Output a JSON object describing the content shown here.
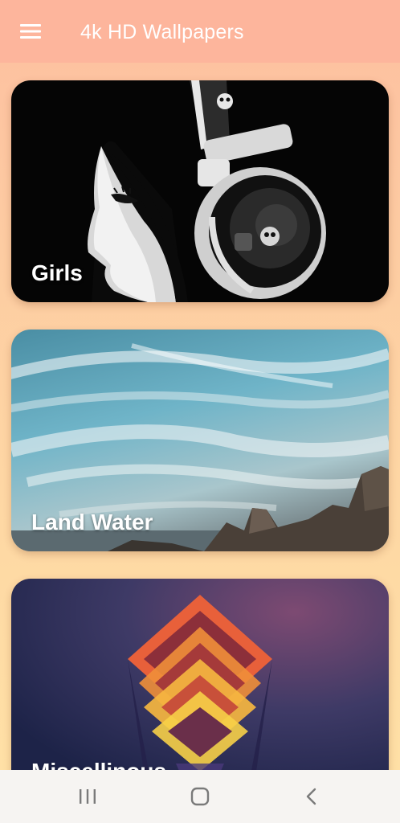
{
  "app_bar": {
    "title": "4k HD Wallpapers",
    "menu_icon": "hamburger-menu-icon",
    "background": "#fdb59c"
  },
  "categories": [
    {
      "label": "Girls",
      "image": "anime-girl-with-skull-headphones"
    },
    {
      "label": "Land Water",
      "image": "cloudy-sky-over-rocky-coast"
    },
    {
      "label": "Miscellinous",
      "image": "abstract-orange-cubes-on-purple"
    }
  ],
  "nav_bar": {
    "buttons": [
      {
        "name": "recent-apps-icon"
      },
      {
        "name": "home-icon"
      },
      {
        "name": "back-icon"
      }
    ]
  },
  "colors": {
    "gradient_top": "#fdbfa0",
    "gradient_bottom": "#ffe2a6",
    "label_text": "#ffffff"
  }
}
